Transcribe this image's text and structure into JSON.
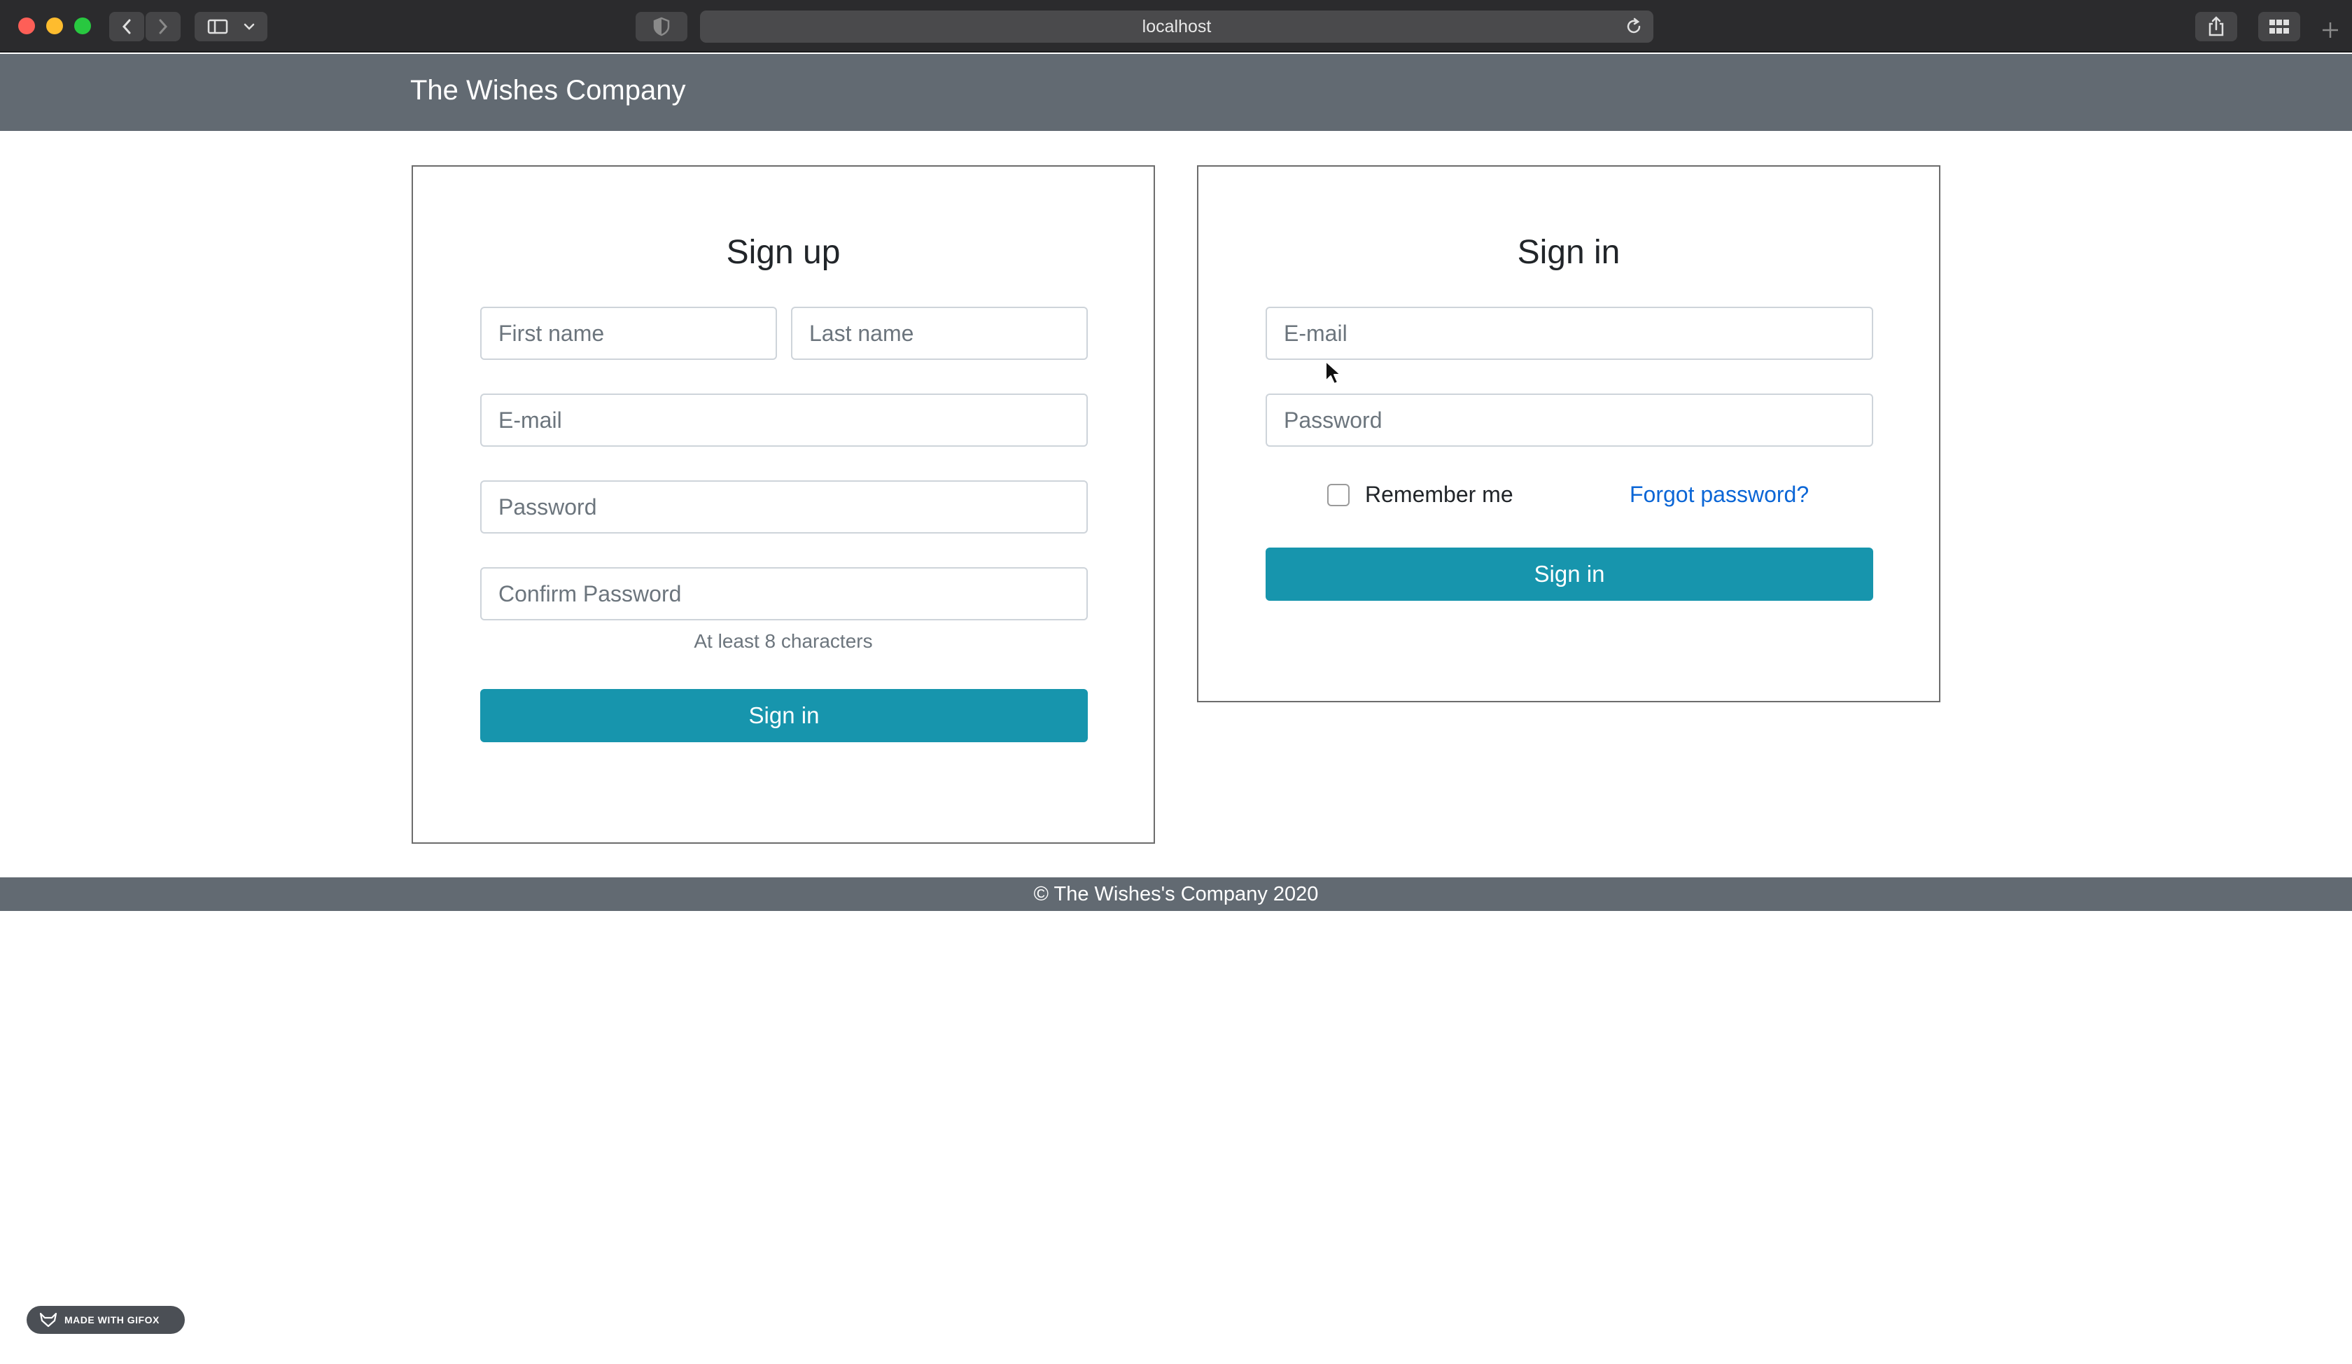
{
  "browser": {
    "url": "localhost"
  },
  "navbar": {
    "brand": "The Wishes Company"
  },
  "signup": {
    "title": "Sign up",
    "first_name_placeholder": "First name",
    "last_name_placeholder": "Last name",
    "email_placeholder": "E-mail",
    "password_placeholder": "Password",
    "confirm_password_placeholder": "Confirm Password",
    "password_hint": "At least 8 characters",
    "submit_label": "Sign in"
  },
  "signin": {
    "title": "Sign in",
    "email_placeholder": "E-mail",
    "password_placeholder": "Password",
    "remember_label": "Remember me",
    "forgot_label": "Forgot password?",
    "submit_label": "Sign in"
  },
  "footer": {
    "text": "© The Wishes's Company 2020"
  },
  "watermark": {
    "text": "MADE WITH GIFOX"
  },
  "colors": {
    "navbar": "#626a72",
    "primary_button": "#1795ad",
    "link": "#0b66d6"
  }
}
